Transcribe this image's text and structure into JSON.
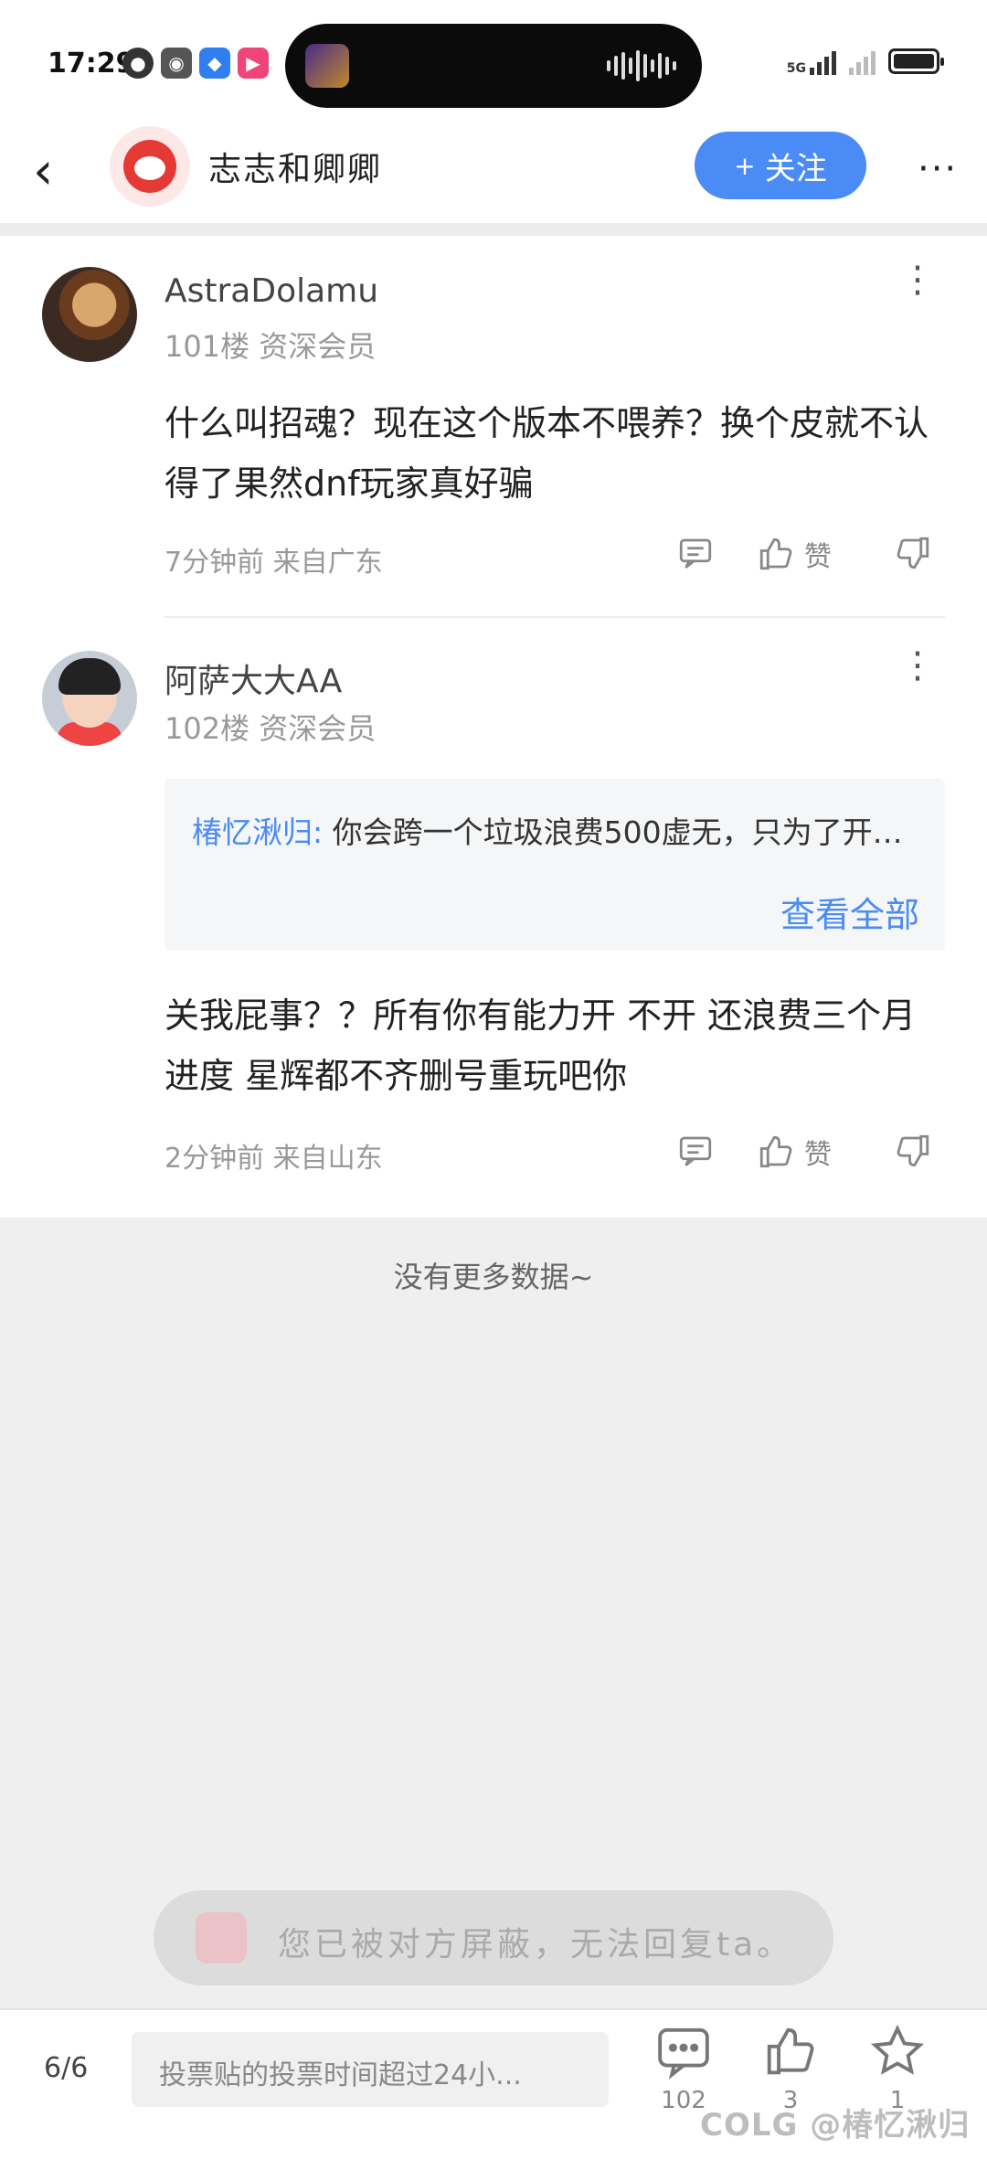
{
  "status_bar": {
    "time": "17:29",
    "network": "5G"
  },
  "header": {
    "back_glyph": "‹",
    "author_name": "志志和卿卿",
    "follow_label": "关注",
    "more_glyph": "···"
  },
  "comments": [
    {
      "user": "AstraDolamu",
      "floor": "101楼 资深会员",
      "body": "什么叫招魂？现在这个版本不喂养？换个皮就不认得了果然dnf玩家真好骗",
      "meta": "7分钟前 来自广东",
      "like_label": "赞"
    },
    {
      "user": "阿萨大大AA",
      "floor": "102楼 资深会员",
      "quote_user": "椿忆湫归:",
      "quote_text": "你会跨一个垃圾浪费500虚无，只为了开…",
      "quote_more": "查看全部",
      "body": "关我屁事？？所有你有能力开 不开 还浪费三个月进度  星辉都不齐删号重玩吧你",
      "meta": "2分钟前 来自山东",
      "like_label": "赞"
    }
  ],
  "no_more": "没有更多数据~",
  "blocked_notice": "您已被对方屏蔽，无法回复ta。",
  "bottom_bar": {
    "page": "6/6",
    "reply_placeholder": "投票贴的投票时间超过24小...",
    "comment_count": "102",
    "like_count": "3",
    "favorite_count": "1"
  },
  "watermark": "COLG @椿忆湫归",
  "colors": {
    "accent": "#4a8bf5",
    "brand_red": "#e53935"
  }
}
